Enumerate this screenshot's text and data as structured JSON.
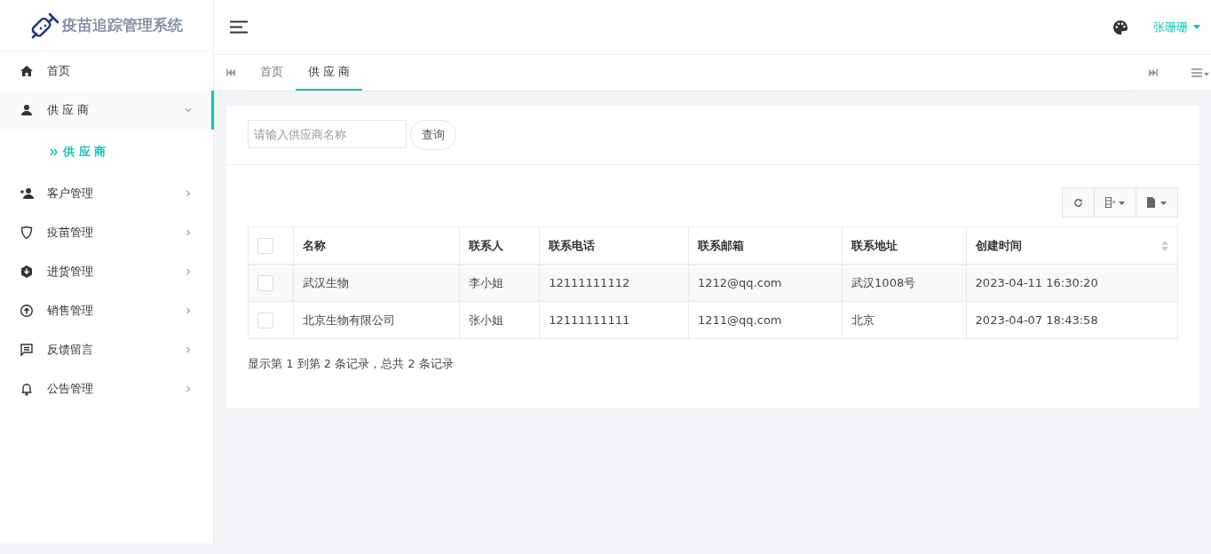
{
  "app": {
    "title": "疫苗追踪管理系统"
  },
  "sidebar": {
    "items": [
      {
        "label": "首页"
      },
      {
        "label": "供 应 商",
        "expanded": true,
        "selected": true,
        "children": [
          {
            "label": "供 应 商",
            "selected": true
          }
        ]
      },
      {
        "label": "客户管理",
        "expanded": false
      },
      {
        "label": "疫苗管理",
        "expanded": false
      },
      {
        "label": "进货管理",
        "expanded": false
      },
      {
        "label": "销售管理",
        "expanded": false
      },
      {
        "label": "反馈留言",
        "expanded": false
      },
      {
        "label": "公告管理",
        "expanded": false
      }
    ]
  },
  "header": {
    "user": "张珊珊"
  },
  "tabs": [
    {
      "label": "首页",
      "selected": false
    },
    {
      "label": "供 应 商",
      "selected": true
    }
  ],
  "search": {
    "placeholder": "请输入供应商名称",
    "button": "查询"
  },
  "table": {
    "select_all": {
      "checked": false
    },
    "columns": [
      "名称",
      "联系人",
      "联系电话",
      "联系邮箱",
      "联系地址",
      "创建时间"
    ],
    "rows": [
      {
        "checked": false,
        "cells": [
          "武汉生物",
          "李小姐",
          "12111111112",
          "1212@qq.com",
          "武汉1008号",
          "2023-04-11 16:30:20"
        ]
      },
      {
        "checked": false,
        "cells": [
          "北京生物有限公司",
          "张小姐",
          "12111111111",
          "1211@qq.com",
          "北京",
          "2023-04-07 18:43:58"
        ]
      }
    ],
    "footer": "显示第 1 到第 2 条记录，总共 2 条记录"
  }
}
